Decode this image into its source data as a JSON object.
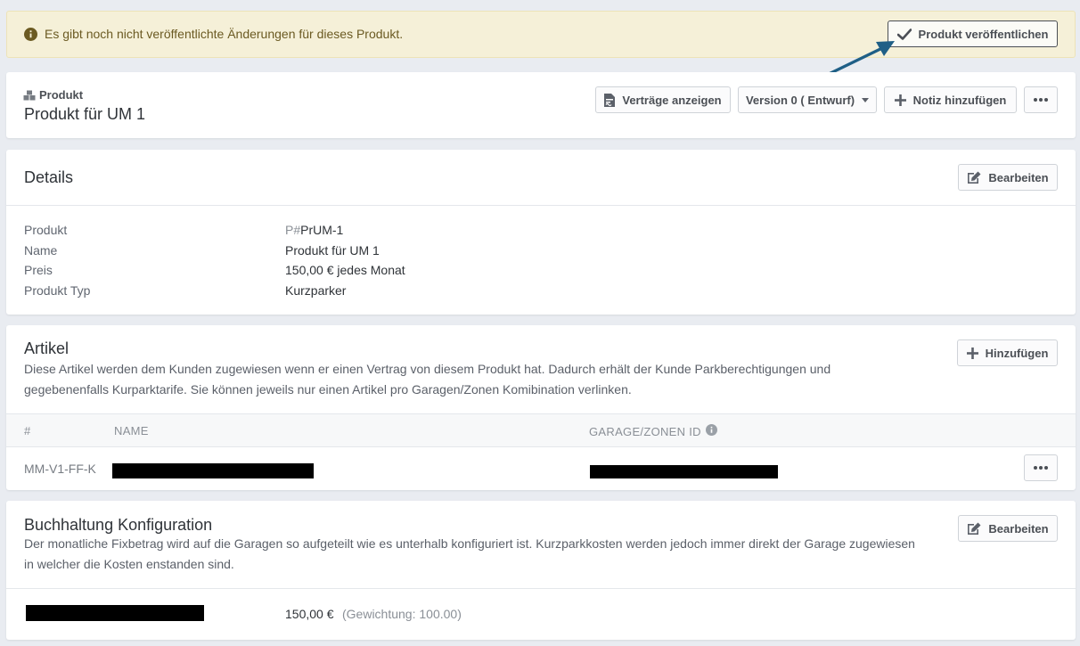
{
  "banner": {
    "message": "Es gibt noch nicht veröffentlichte Änderungen für dieses Produkt.",
    "publish_label": "Produkt veröffentlichen",
    "info_icon": "info-circle-icon",
    "check_icon": "check-icon",
    "annotation_arrow_color": "#1f5f86"
  },
  "header": {
    "type_label": "Produkt",
    "type_icon": "cubes-icon",
    "title": "Produkt für UM 1",
    "contracts_label": "Verträge anzeigen",
    "version_label": "Version 0 ( Entwurf)",
    "note_label": "Notiz hinzufügen"
  },
  "details": {
    "title": "Details",
    "edit_label": "Bearbeiten",
    "rows": [
      {
        "label": "Produkt",
        "prefix": "P#",
        "value": "PrUM-1"
      },
      {
        "label": "Name",
        "prefix": "",
        "value": "Produkt für UM 1"
      },
      {
        "label": "Preis",
        "prefix": "",
        "value": "150,00 € jedes Monat"
      },
      {
        "label": "Produkt Typ",
        "prefix": "",
        "value": "Kurzparker"
      }
    ]
  },
  "articles": {
    "title": "Artikel",
    "description": "Diese Artikel werden dem Kunden zugewiesen wenn er einen Vertrag von diesem Produkt hat. Dadurch erhält der Kunde Parkberechtigungen und gegebenenfalls Kurparktarife. Sie können jeweils nur einen Artikel pro Garagen/Zonen Komibination verlinken.",
    "add_label": "Hinzufügen",
    "columns": [
      "#",
      "NAME",
      "GARAGE/ZONEN ID"
    ],
    "rows": [
      {
        "id": "MM-V1-FF-K"
      }
    ]
  },
  "accounting": {
    "title": "Buchhaltung Konfiguration",
    "description": "Der monatliche Fixbetrag wird auf die Garagen so aufgeteilt wie es unterhalb konfiguriert ist. Kurzparkkosten werden jedoch immer direkt der Garage zugewiesen in welcher die Kosten enstanden sind.",
    "edit_label": "Bearbeiten",
    "rows": [
      {
        "amount": "150,00 €",
        "weight": "(Gewichtung: 100.00)"
      }
    ]
  }
}
